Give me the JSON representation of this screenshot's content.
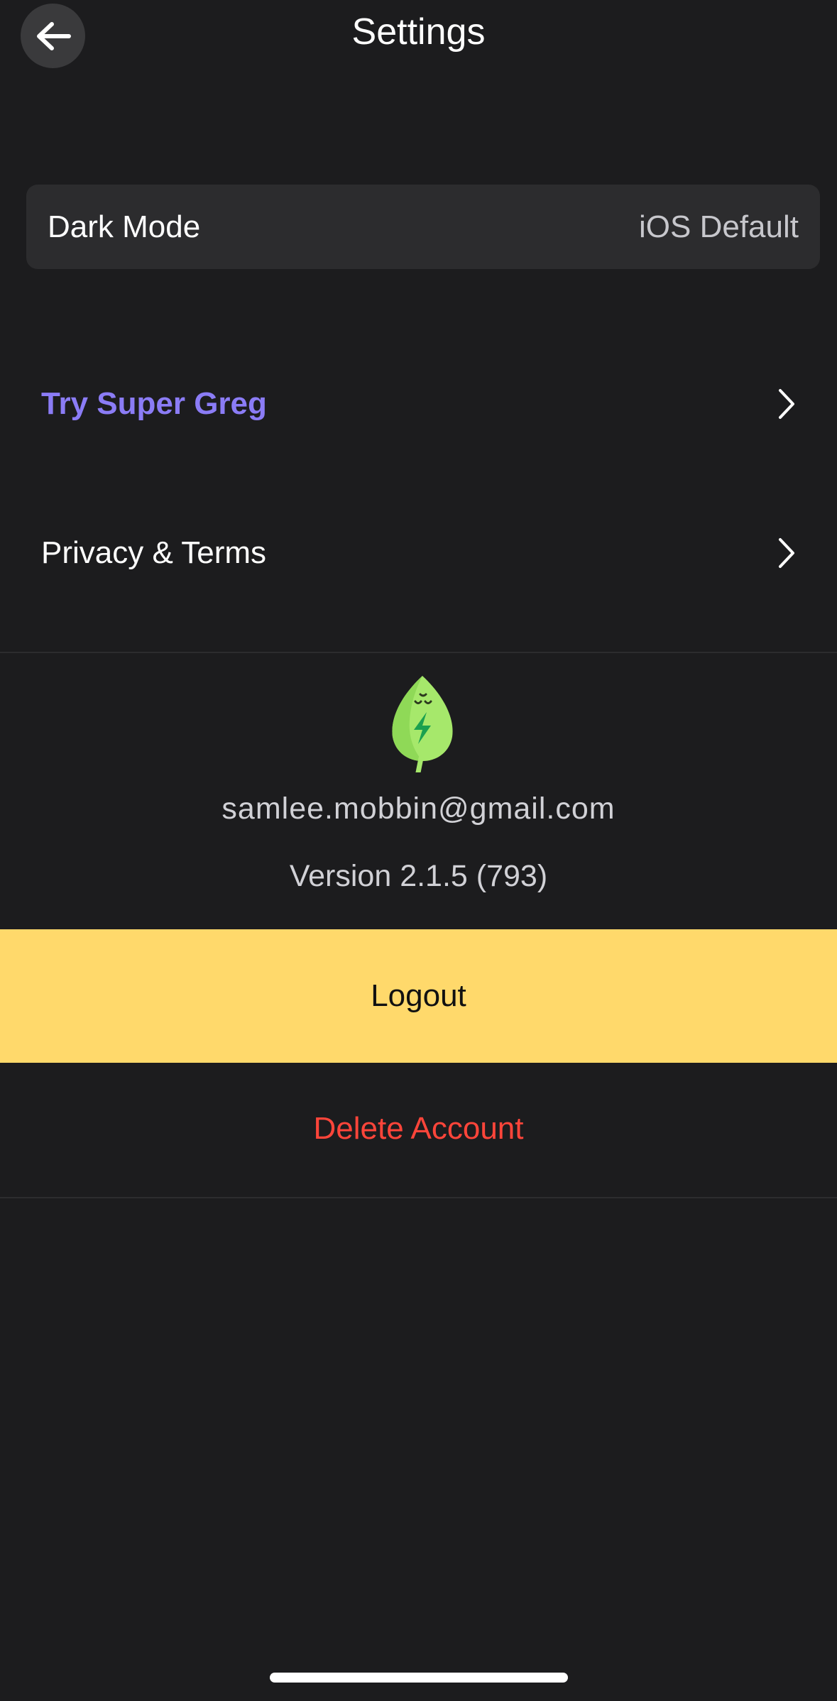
{
  "header": {
    "title": "Settings",
    "back_icon": "arrow-left-icon"
  },
  "dark_mode": {
    "label": "Dark Mode",
    "value": "iOS Default"
  },
  "menu": {
    "super": {
      "label": "Try Super Greg",
      "color": "#8b7cf6",
      "icon": "chevron-right-icon"
    },
    "privacy": {
      "label": "Privacy & Terms",
      "icon": "chevron-right-icon"
    }
  },
  "account": {
    "logo_icon": "leaf-logo-icon",
    "email": "samlee.mobbin@gmail.com",
    "version": "Version 2.1.5 (793)"
  },
  "actions": {
    "logout_label": "Logout",
    "logout_color": "#ffd96b",
    "delete_label": "Delete Account",
    "delete_color": "#ff453a"
  },
  "theme": {
    "background": "#1c1c1e",
    "card": "#2c2c2e"
  }
}
